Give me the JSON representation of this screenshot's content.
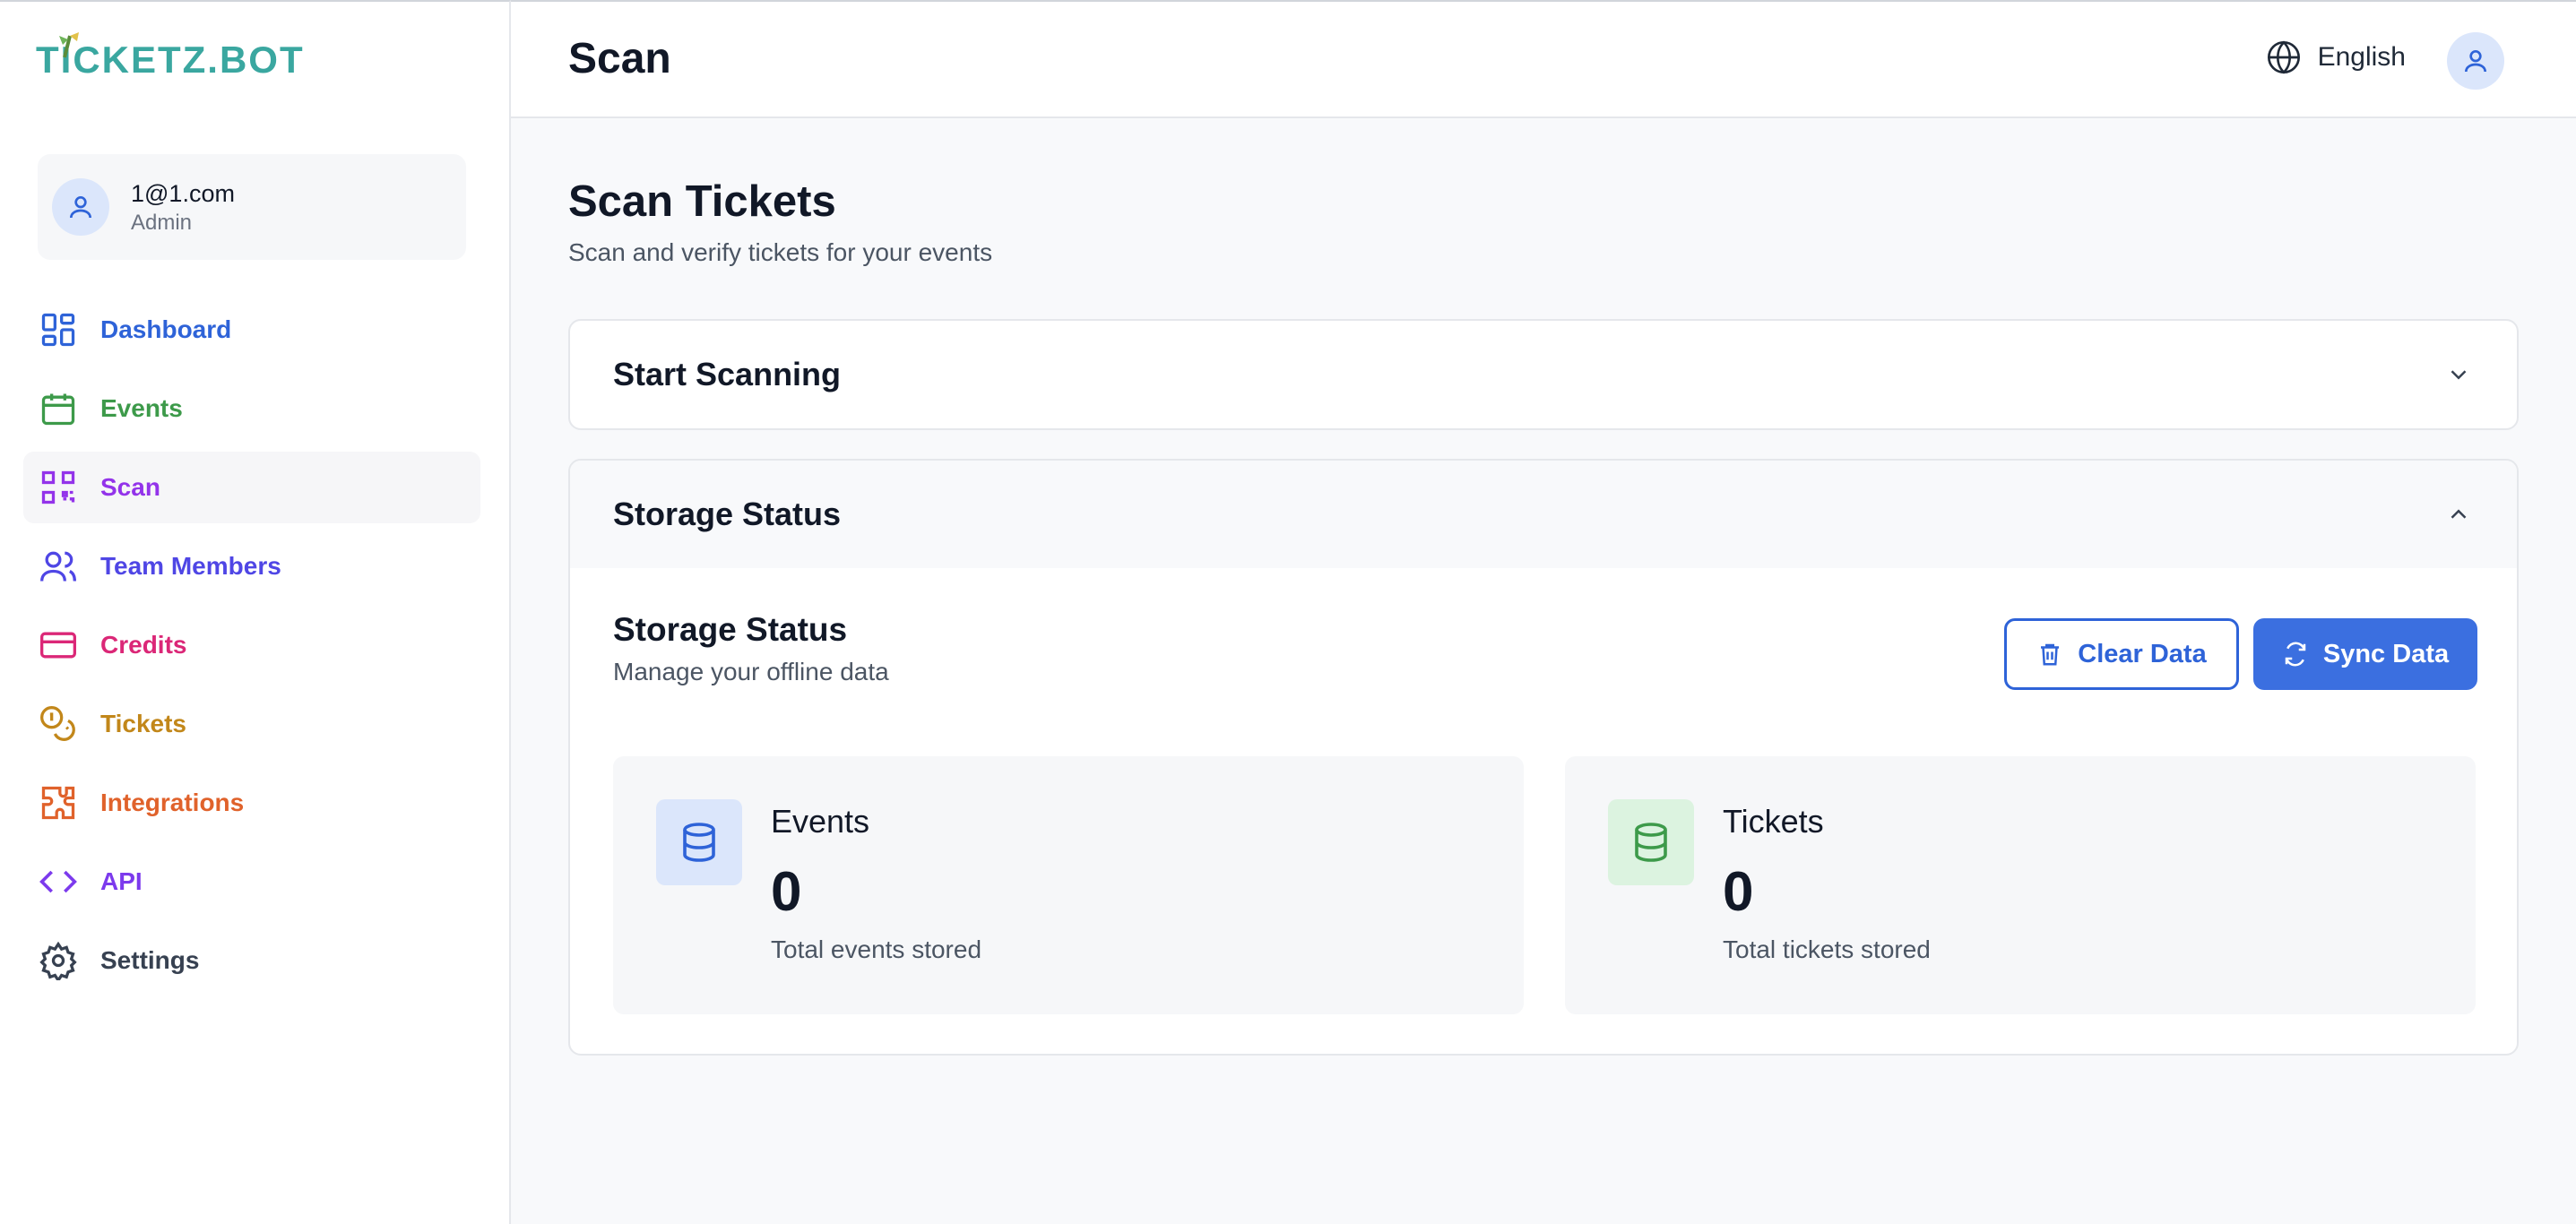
{
  "brand": {
    "logo_text": "TICKETZ.BOT"
  },
  "user": {
    "email": "1@1.com",
    "role": "Admin"
  },
  "nav": [
    {
      "label": "Dashboard",
      "icon": "dashboard-icon",
      "color": "#2e63d8",
      "active": false
    },
    {
      "label": "Events",
      "icon": "calendar-icon",
      "color": "#3d9a4a",
      "active": false
    },
    {
      "label": "Scan",
      "icon": "qr-code-icon",
      "color": "#9333ea",
      "active": true
    },
    {
      "label": "Team Members",
      "icon": "users-icon",
      "color": "#4f46e5",
      "active": false
    },
    {
      "label": "Credits",
      "icon": "credit-card-icon",
      "color": "#db2777",
      "active": false
    },
    {
      "label": "Tickets",
      "icon": "coins-icon",
      "color": "#c2871a",
      "active": false
    },
    {
      "label": "Integrations",
      "icon": "puzzle-icon",
      "color": "#e0622b",
      "active": false
    },
    {
      "label": "API",
      "icon": "code-icon",
      "color": "#7c3aed",
      "active": false
    },
    {
      "label": "Settings",
      "icon": "gear-icon",
      "color": "#374151",
      "active": false
    }
  ],
  "header": {
    "title": "Scan",
    "language": "English"
  },
  "main": {
    "title": "Scan Tickets",
    "subtitle": "Scan and verify tickets for your events",
    "start_scanning": {
      "title": "Start Scanning",
      "expanded": false
    },
    "storage_panel": {
      "title": "Storage Status",
      "expanded": true
    },
    "storage": {
      "title": "Storage Status",
      "subtitle": "Manage your offline data",
      "clear_label": "Clear Data",
      "sync_label": "Sync Data",
      "stats": [
        {
          "label": "Events",
          "value": "0",
          "caption": "Total events stored",
          "icon": "database-icon",
          "color": "#2e63d8",
          "bg": "#dbe6fb"
        },
        {
          "label": "Tickets",
          "value": "0",
          "caption": "Total tickets stored",
          "icon": "database-icon",
          "color": "#3d9a4a",
          "bg": "#dcf3e0"
        }
      ]
    }
  }
}
